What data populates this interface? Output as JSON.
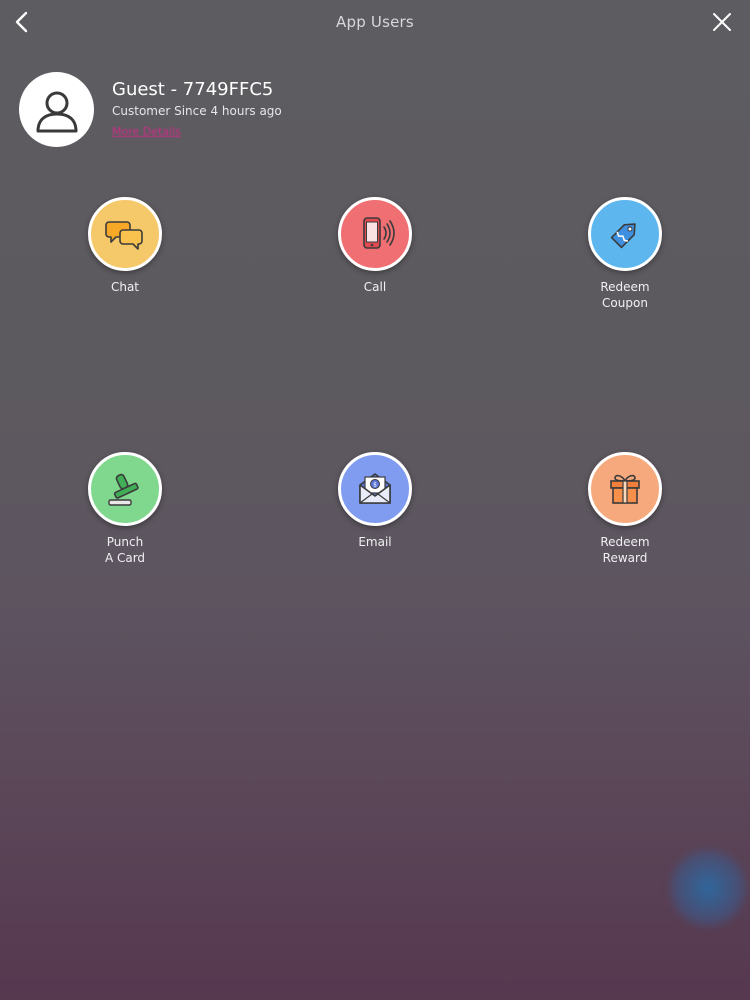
{
  "header": {
    "title": "App Users",
    "back_icon": "chevron-left-icon",
    "close_icon": "close-icon"
  },
  "profile": {
    "name": "Guest - 7749FFC5",
    "customer_since": "Customer Since 4 hours ago",
    "link": "More Details"
  },
  "actions": [
    {
      "label": "Chat",
      "icon": "chat-bubbles-icon",
      "color": "#f5c96a"
    },
    {
      "label": "Call",
      "icon": "phone-ringing-icon",
      "color": "#ef6f73"
    },
    {
      "label": "Redeem\nCoupon",
      "icon": "coupon-tag-icon",
      "color": "#5eb6ee"
    },
    {
      "label": "Punch\nA Card",
      "icon": "stamp-icon",
      "color": "#80d88e"
    },
    {
      "label": "Email",
      "icon": "envelope-icon",
      "color": "#7f9cf0"
    },
    {
      "label": "Redeem\nReward",
      "icon": "gift-icon",
      "color": "#f5a97c"
    }
  ],
  "colors": {
    "accent_link": "#d02c8a",
    "background_top": "#5d5c60",
    "background_bottom": "#56384f"
  }
}
